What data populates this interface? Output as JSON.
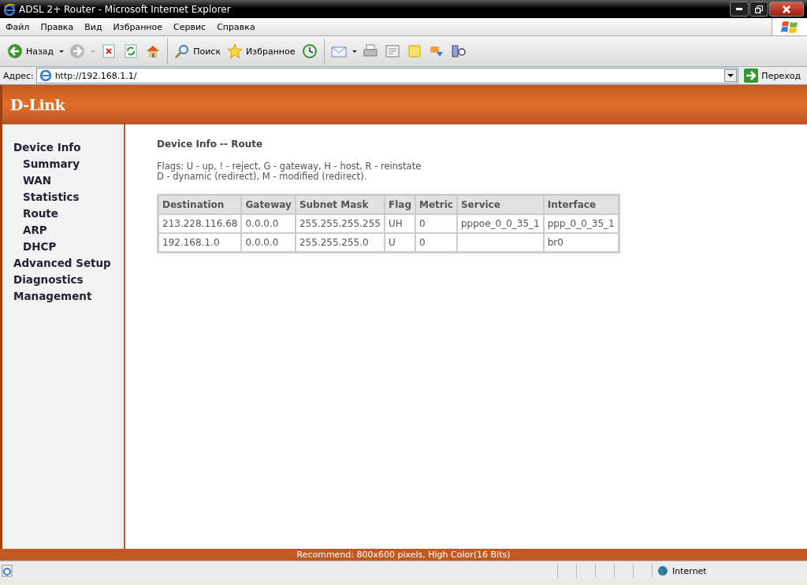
{
  "window": {
    "title": "ADSL 2+ Router - Microsoft Internet Explorer"
  },
  "menu": [
    "Файл",
    "Правка",
    "Вид",
    "Избранное",
    "Сервис",
    "Справка"
  ],
  "toolbar": {
    "back": "Назад",
    "search": "Поиск",
    "favorites": "Избранное"
  },
  "address": {
    "label": "Адрес:",
    "value": "http://192.168.1.1/",
    "go": "Переход"
  },
  "logo": "D-Link",
  "sidebar": {
    "items": [
      {
        "label": "Device Info",
        "children": [
          {
            "label": "Summary"
          },
          {
            "label": "WAN"
          },
          {
            "label": "Statistics"
          },
          {
            "label": "Route"
          },
          {
            "label": "ARP"
          },
          {
            "label": "DHCP"
          }
        ]
      },
      {
        "label": "Advanced Setup"
      },
      {
        "label": "Diagnostics"
      },
      {
        "label": "Management"
      }
    ]
  },
  "content": {
    "heading": "Device Info -- Route",
    "flags": [
      "Flags: U - up, ! - reject, G - gateway, H - host, R - reinstate",
      "D - dynamic (redirect), M - modified (redirect)."
    ],
    "table": {
      "columns": [
        "Destination",
        "Gateway",
        "Subnet Mask",
        "Flag",
        "Metric",
        "Service",
        "Interface"
      ],
      "rows": [
        [
          "213.228.116.68",
          "0.0.0.0",
          "255.255.255.255",
          "UH",
          "0",
          "pppoe_0_0_35_1",
          "ppp_0_0_35_1"
        ],
        [
          "192.168.1.0",
          "0.0.0.0",
          "255.255.255.0",
          "U",
          "0",
          null,
          "br0"
        ]
      ]
    }
  },
  "footer": "Recommend: 800x600 pixels, High Color(16 Bits)",
  "status_bar": {
    "zone": "Internet"
  }
}
